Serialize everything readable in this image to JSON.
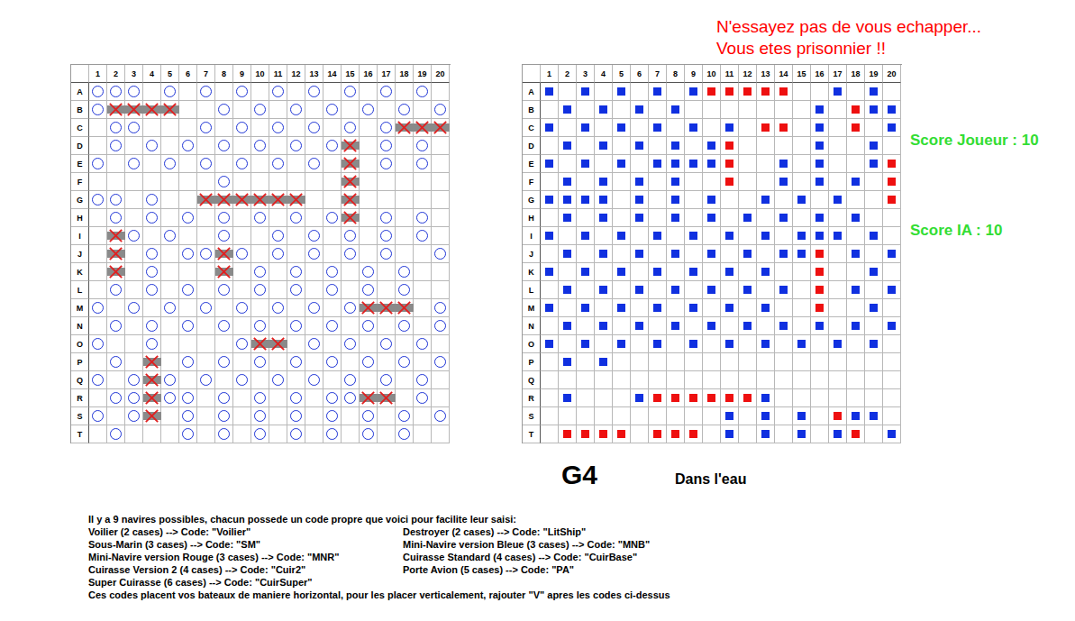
{
  "banner": [
    "N'essayez pas de vous echapper...",
    "Vous etes prisonnier !!"
  ],
  "player_board": {
    "columns": [
      "1",
      "2",
      "3",
      "4",
      "5",
      "6",
      "7",
      "8",
      "9",
      "10",
      "11",
      "12",
      "13",
      "14",
      "15",
      "16",
      "17",
      "18",
      "19",
      "20"
    ],
    "rows": [
      {
        "label": "A",
        "cells": "ooo.o.o.o.o.o.o.o.o."
      },
      {
        "label": "B",
        "cells": "oxxxx..o.o.o.o.o.o.o"
      },
      {
        "label": "C",
        "cells": ".oo...o.o.o.o.o.oxxx"
      },
      {
        "label": "D",
        "cells": ".o.o.o.o.o.o.ox.o.o."
      },
      {
        "label": "E",
        "cells": "o.o.o.o.o.o.o.x.o.o."
      },
      {
        "label": "F",
        "cells": ".......o......x....."
      },
      {
        "label": "G",
        "cells": "oo.o..xxxxxx..x....."
      },
      {
        "label": "H",
        "cells": ".o.o.o.o.o.o.ox.o.o."
      },
      {
        "label": "I",
        "cells": ".xo.o..o..o.o.o.o.o."
      },
      {
        "label": "J",
        "cells": ".x.o.ooxo.o.o.o.o..o"
      },
      {
        "label": "K",
        "cells": ".x.o...x.o.o.o.o.o.."
      },
      {
        "label": "L",
        "cells": ".o.o.o.o.o.o.o.o.o.."
      },
      {
        "label": "M",
        "cells": "o.o.o.o.o.o.o.oxxx.o"
      },
      {
        "label": "N",
        "cells": ".o.o.o.o.o.o.o.o.o.o"
      },
      {
        "label": "O",
        "cells": "o..o....oxx.o.o.o.o."
      },
      {
        "label": "P",
        "cells": ".o.x.o.o.o.o.o.o.o.o"
      },
      {
        "label": "Q",
        "cells": "o.oxo.o.o.o.o.o.o.o."
      },
      {
        "label": "R",
        "cells": ".ooxoo.o.o.o.ooxx.o."
      },
      {
        "label": "S",
        "cells": "o.ox.o.o.o.o.o.o.o.o"
      },
      {
        "label": "T",
        "cells": ".o...o.o.o.o.o.o.o.."
      }
    ]
  },
  "enemy_board": {
    "columns": [
      "1",
      "2",
      "3",
      "4",
      "5",
      "6",
      "7",
      "8",
      "9",
      "10",
      "11",
      "12",
      "13",
      "14",
      "15",
      "16",
      "17",
      "18",
      "19",
      "20"
    ],
    "rows": [
      {
        "label": "A",
        "cells": "b.b.b.b.brrrrr..b.b."
      },
      {
        "label": "B",
        "cells": ".b.b.b.b.......b.rbb"
      },
      {
        "label": "C",
        "cells": "b.b.b.b.b.b.rr.b.r.b"
      },
      {
        "label": "D",
        "cells": ".b.b.b.b.br....b..b."
      },
      {
        "label": "E",
        "cells": "b.b.b.bbbbr..b.b..br"
      },
      {
        "label": "F",
        "cells": ".b.b.b.b..r..b.b.b.r"
      },
      {
        "label": "G",
        "cells": "bbbb.b.b.b..b.b.b..r"
      },
      {
        "label": "H",
        "cells": ".b.b.b.b.b.b.b.b.b.."
      },
      {
        "label": "I",
        "cells": "b.b.b.b.b.b.b.bbb.b."
      },
      {
        "label": "J",
        "cells": ".b.b.b.b.b.b.bbr.b.b"
      },
      {
        "label": "K",
        "cells": "b.b.b.b.b.b.b..r..b."
      },
      {
        "label": "L",
        "cells": ".b.b.b.b.b.b.b.r.b.b"
      },
      {
        "label": "M",
        "cells": "b.b.b.b.b.b.b..r..b."
      },
      {
        "label": "N",
        "cells": ".b.b.b.b.b.b.b.b.b.b"
      },
      {
        "label": "O",
        "cells": "b.b.b.b.b.b.b.b.b.b."
      },
      {
        "label": "P",
        "cells": ".b.b................"
      },
      {
        "label": "Q",
        "cells": "...................."
      },
      {
        "label": "R",
        "cells": ".b...brrrrrrb......."
      },
      {
        "label": "S",
        "cells": "..........b.b.b.rbb."
      },
      {
        "label": "T",
        "cells": ".rrrr.rrr.b.b.b.br.b"
      }
    ]
  },
  "scores": [
    "Score Joueur : 10",
    "Score IA : 10"
  ],
  "last_shot": {
    "coordinate": "G4",
    "result": "Dans l'eau"
  },
  "help": {
    "intro": "Il y a 9 navires possibles, chacun possede un code propre que voici pour facilite leur saisi:",
    "ships": [
      "Voilier (2 cases) --> Code: \"Voilier\"",
      "Destroyer (2 cases) --> Code: \"LitShip\"",
      "Sous-Marin (3 cases) --> Code: \"SM\"",
      "Mini-Navire version Bleue (3 cases) --> Code: \"MNB\"",
      "Mini-Navire version Rouge (3 cases) --> Code: \"MNR\"",
      "Cuirasse Standard (4 cases) --> Code: \"CuirBase\"",
      "Cuirasse Version 2 (4 cases) --> Code: \"Cuir2\"",
      "Porte Avion (5 cases) --> Code: \"PA\"",
      "Super Cuirasse (6 cases) --> Code: \"CuirSuper\""
    ],
    "note": "Ces codes placent vos bateaux de maniere horizontal, pour les placer verticalement, rajouter \"V\" apres les codes ci-dessus"
  }
}
